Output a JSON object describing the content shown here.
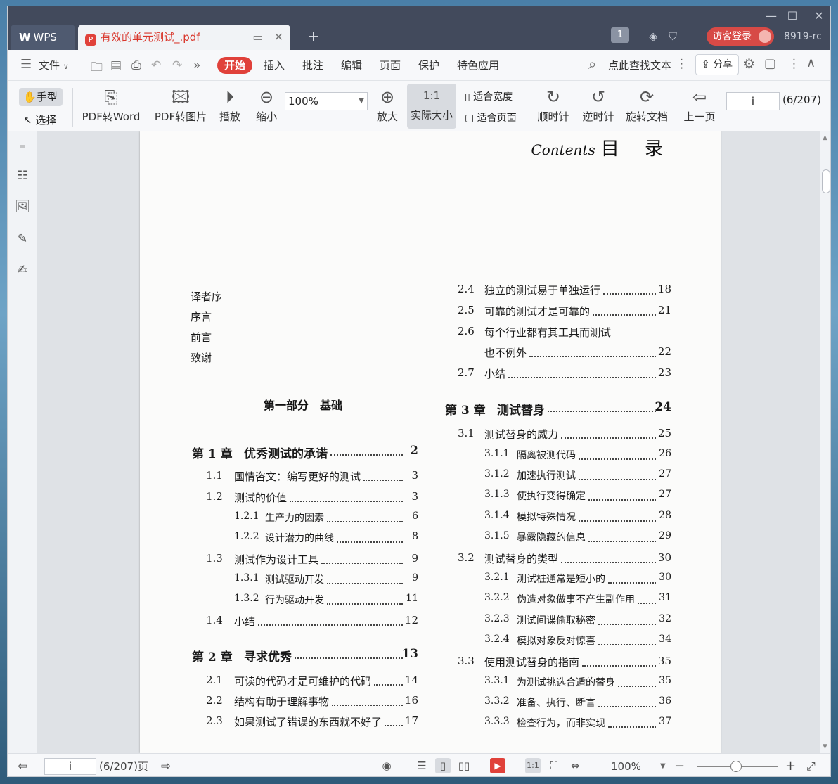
{
  "titlebar": {
    "wps_tab": "WPS",
    "doc_tab": "有效的单元测试_.pdf",
    "page_badge": "1",
    "guest_login": "访客登录",
    "user_code": "8919-rc"
  },
  "menubar": {
    "file": "文件",
    "tabs": [
      "开始",
      "插入",
      "批注",
      "编辑",
      "页面",
      "保护",
      "特色应用"
    ],
    "search": "点此查找文本",
    "share": "分享"
  },
  "toolbar": {
    "hand": "手型",
    "select": "选择",
    "pdf_to_word": "PDF转Word",
    "pdf_to_image": "PDF转图片",
    "play": "播放",
    "zoom_out": "缩小",
    "zoom_value": "100%",
    "zoom_in": "放大",
    "actual_size": "实际大小",
    "fit_width": "适合宽度",
    "fit_page": "适合页面",
    "clockwise": "顺时针",
    "counterclockwise": "逆时针",
    "rotate_doc": "旋转文档",
    "prev_page": "上一页",
    "page_value": "i",
    "page_count": "(6/207)"
  },
  "document": {
    "contents_en": "Contents",
    "contents_cn": "目 录",
    "front_matter": [
      "译者序",
      "序言",
      "前言",
      "致谢"
    ],
    "part1": "第一部分　基础",
    "left_toc": [
      {
        "num": "第 1 章",
        "title": "优秀测试的承诺",
        "page": "2",
        "level": "ch"
      },
      {
        "num": "1.1",
        "title": "国情咨文：编写更好的测试",
        "page": "3",
        "level": "sec"
      },
      {
        "num": "1.2",
        "title": "测试的价值",
        "page": "3",
        "level": "sec"
      },
      {
        "num": "1.2.1",
        "title": "生产力的因素",
        "page": "6",
        "level": "sub"
      },
      {
        "num": "1.2.2",
        "title": "设计潜力的曲线",
        "page": "8",
        "level": "sub"
      },
      {
        "num": "1.3",
        "title": "测试作为设计工具",
        "page": "9",
        "level": "sec"
      },
      {
        "num": "1.3.1",
        "title": "测试驱动开发",
        "page": "9",
        "level": "sub"
      },
      {
        "num": "1.3.2",
        "title": "行为驱动开发",
        "page": "11",
        "level": "sub"
      },
      {
        "num": "1.4",
        "title": "小结",
        "page": "12",
        "level": "sec"
      },
      {
        "num": "第 2 章",
        "title": "寻求优秀",
        "page": "13",
        "level": "ch"
      },
      {
        "num": "2.1",
        "title": "可读的代码才是可维护的代码",
        "page": "14",
        "level": "sec"
      },
      {
        "num": "2.2",
        "title": "结构有助于理解事物",
        "page": "16",
        "level": "sec"
      },
      {
        "num": "2.3",
        "title": "如果测试了错误的东西就不好了",
        "page": "17",
        "level": "sec"
      }
    ],
    "right_toc": [
      {
        "num": "2.4",
        "title": "独立的测试易于单独运行",
        "page": "18",
        "level": "sec"
      },
      {
        "num": "2.5",
        "title": "可靠的测试才是可靠的",
        "page": "21",
        "level": "sec"
      },
      {
        "num": "2.6",
        "title": "每个行业都有其工具而测试",
        "page": "",
        "level": "sec"
      },
      {
        "num": "",
        "title": "也不例外",
        "page": "22",
        "level": "sec"
      },
      {
        "num": "2.7",
        "title": "小结",
        "page": "23",
        "level": "sec"
      },
      {
        "num": "第 3 章",
        "title": "测试替身",
        "page": "24",
        "level": "ch"
      },
      {
        "num": "3.1",
        "title": "测试替身的威力",
        "page": "25",
        "level": "sec"
      },
      {
        "num": "3.1.1",
        "title": "隔离被测代码",
        "page": "26",
        "level": "sub"
      },
      {
        "num": "3.1.2",
        "title": "加速执行测试",
        "page": "27",
        "level": "sub"
      },
      {
        "num": "3.1.3",
        "title": "使执行变得确定",
        "page": "27",
        "level": "sub"
      },
      {
        "num": "3.1.4",
        "title": "模拟特殊情况",
        "page": "28",
        "level": "sub"
      },
      {
        "num": "3.1.5",
        "title": "暴露隐藏的信息",
        "page": "29",
        "level": "sub"
      },
      {
        "num": "3.2",
        "title": "测试替身的类型",
        "page": "30",
        "level": "sec"
      },
      {
        "num": "3.2.1",
        "title": "测试桩通常是短小的",
        "page": "30",
        "level": "sub"
      },
      {
        "num": "3.2.2",
        "title": "伪造对象做事不产生副作用",
        "page": "31",
        "level": "sub"
      },
      {
        "num": "3.2.3",
        "title": "测试间谍偷取秘密",
        "page": "32",
        "level": "sub"
      },
      {
        "num": "3.2.4",
        "title": "模拟对象反对惊喜",
        "page": "34",
        "level": "sub"
      },
      {
        "num": "3.3",
        "title": "使用测试替身的指南",
        "page": "35",
        "level": "sec"
      },
      {
        "num": "3.3.1",
        "title": "为测试挑选合适的替身",
        "page": "35",
        "level": "sub"
      },
      {
        "num": "3.3.2",
        "title": "准备、执行、断言",
        "page": "36",
        "level": "sub"
      },
      {
        "num": "3.3.3",
        "title": "检查行为，而非实现",
        "page": "37",
        "level": "sub"
      }
    ]
  },
  "statusbar": {
    "page_value": "i",
    "page_label": "(6/207)页",
    "zoom": "100%"
  }
}
